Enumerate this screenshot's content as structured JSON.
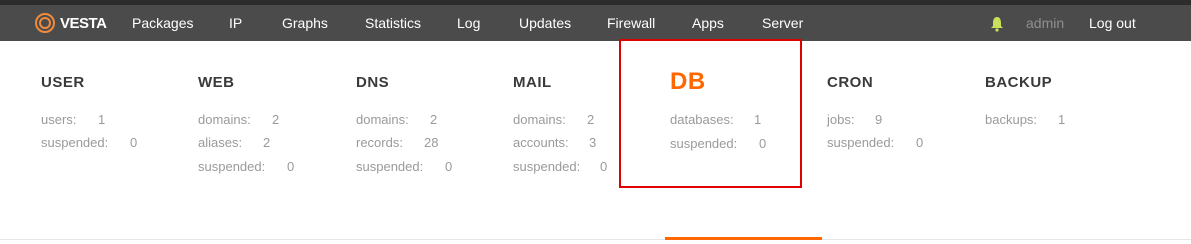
{
  "brand": {
    "name": "VESTA",
    "accent": "#ff6701"
  },
  "nav": {
    "items": [
      "Packages",
      "IP",
      "Graphs",
      "Statistics",
      "Log",
      "Updates",
      "Firewall",
      "Apps",
      "Server"
    ],
    "user": "admin",
    "logout": "Log out",
    "notification_icon": "bell-icon"
  },
  "panels": [
    {
      "title": "USER",
      "stats": [
        {
          "label": "users:",
          "value": "1"
        },
        {
          "label": "suspended:",
          "value": "0"
        }
      ]
    },
    {
      "title": "WEB",
      "stats": [
        {
          "label": "domains:",
          "value": "2"
        },
        {
          "label": "aliases:",
          "value": "2"
        },
        {
          "label": "suspended:",
          "value": "0"
        }
      ]
    },
    {
      "title": "DNS",
      "stats": [
        {
          "label": "domains:",
          "value": "2"
        },
        {
          "label": "records:",
          "value": "28"
        },
        {
          "label": "suspended:",
          "value": "0"
        }
      ]
    },
    {
      "title": "MAIL",
      "stats": [
        {
          "label": "domains:",
          "value": "2"
        },
        {
          "label": "accounts:",
          "value": "3"
        },
        {
          "label": "suspended:",
          "value": "0"
        }
      ]
    },
    {
      "title": "DB",
      "active": true,
      "stats": [
        {
          "label": "databases:",
          "value": "1"
        },
        {
          "label": "suspended:",
          "value": "0"
        }
      ]
    },
    {
      "title": "CRON",
      "stats": [
        {
          "label": "jobs:",
          "value": "9"
        },
        {
          "label": "suspended:",
          "value": "0"
        }
      ]
    },
    {
      "title": "BACKUP",
      "stats": [
        {
          "label": "backups:",
          "value": "1"
        }
      ]
    }
  ],
  "colors": {
    "highlight_box": "#e10000",
    "navbar": "#4b4b4b"
  }
}
